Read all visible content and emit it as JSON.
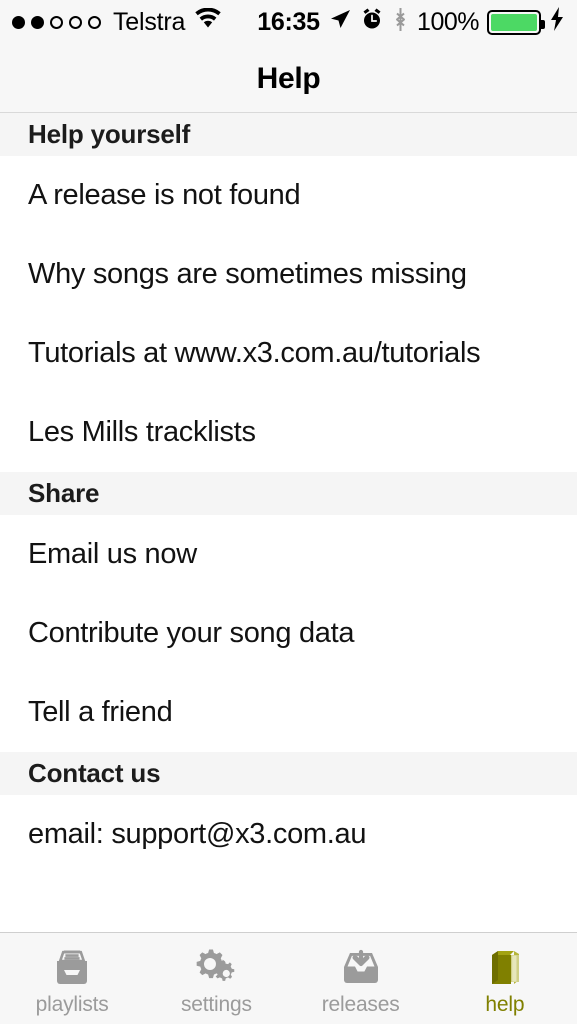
{
  "status_bar": {
    "carrier": "Telstra",
    "signal_dots_filled": 2,
    "signal_dots_total": 5,
    "time": "16:35",
    "battery_percent": "100%",
    "battery_color": "#4cd964",
    "icons": [
      "wifi-icon",
      "location-arrow-icon",
      "alarm-clock-icon",
      "bluetooth-icon",
      "battery-icon",
      "charging-bolt-icon"
    ]
  },
  "navbar": {
    "title": "Help"
  },
  "sections": [
    {
      "header": "Help yourself",
      "rows": [
        "A release is not found",
        "Why songs are sometimes missing",
        "Tutorials at www.x3.com.au/tutorials",
        "Les Mills tracklists"
      ]
    },
    {
      "header": "Share",
      "rows": [
        "Email us now",
        "Contribute your song data",
        "Tell a friend"
      ]
    },
    {
      "header": "Contact us",
      "rows": [
        "email: support@x3.com.au"
      ]
    }
  ],
  "tabbar": {
    "active_color": "#808000",
    "inactive_color": "#9b9b9b",
    "tabs": [
      {
        "label": "playlists",
        "icon": "tray-documents-icon",
        "active": false
      },
      {
        "label": "settings",
        "icon": "gears-icon",
        "active": false
      },
      {
        "label": "releases",
        "icon": "inbox-download-icon",
        "active": false
      },
      {
        "label": "help",
        "icon": "book-icon",
        "active": true
      }
    ]
  }
}
